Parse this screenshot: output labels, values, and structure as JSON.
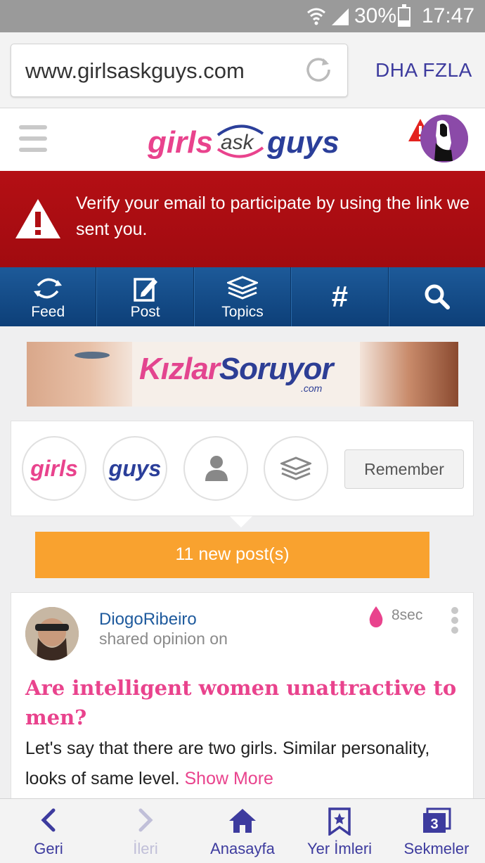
{
  "status_bar": {
    "battery": "30%",
    "time": "17:47"
  },
  "browser": {
    "url": "www.girlsaskguys.com",
    "more_label": "DHA FZLA"
  },
  "site": {
    "logo": {
      "part1": "girls",
      "part2": "ask",
      "part3": "guys"
    }
  },
  "verify_banner": {
    "message": "Verify your email to participate by using the link we sent you."
  },
  "nav": [
    {
      "label": "Feed",
      "icon": "feed-icon"
    },
    {
      "label": "Post",
      "icon": "post-icon"
    },
    {
      "label": "Topics",
      "icon": "topics-icon"
    },
    {
      "label": "#",
      "icon": "hashtag-icon"
    },
    {
      "label": "",
      "icon": "search-icon"
    }
  ],
  "ad": {
    "brand_part1": "Kızlar",
    "brand_part2": "Soruyor",
    "brand_suffix": ".com"
  },
  "filters": {
    "girls": "girls",
    "guys": "guys",
    "remember": "Remember"
  },
  "new_posts": "11 new post(s)",
  "post": {
    "username": "DiogoRibeiro",
    "action": "shared opinion on",
    "time": "8sec",
    "title": "Are intelligent women unattractive to men?",
    "body": "Let's say that there are two girls. Similar personality, looks of same level.",
    "show_more": "Show More"
  },
  "bottom_toolbar": [
    {
      "label": "Geri",
      "icon": "back-icon",
      "enabled": true
    },
    {
      "label": "İleri",
      "icon": "forward-icon",
      "enabled": false
    },
    {
      "label": "Anasayfa",
      "icon": "home-icon",
      "enabled": true
    },
    {
      "label": "Yer İmleri",
      "icon": "bookmark-icon",
      "enabled": true
    },
    {
      "label": "Sekmeler",
      "icon": "tabs-icon",
      "enabled": true,
      "badge": "3"
    }
  ],
  "colors": {
    "brand_pink": "#e9438d",
    "brand_blue": "#2b3f9a",
    "alert_red": "#a10b10",
    "nav_blue": "#0d3f78",
    "new_posts_orange": "#f9a22f",
    "browser_accent": "#3d3b9e"
  }
}
